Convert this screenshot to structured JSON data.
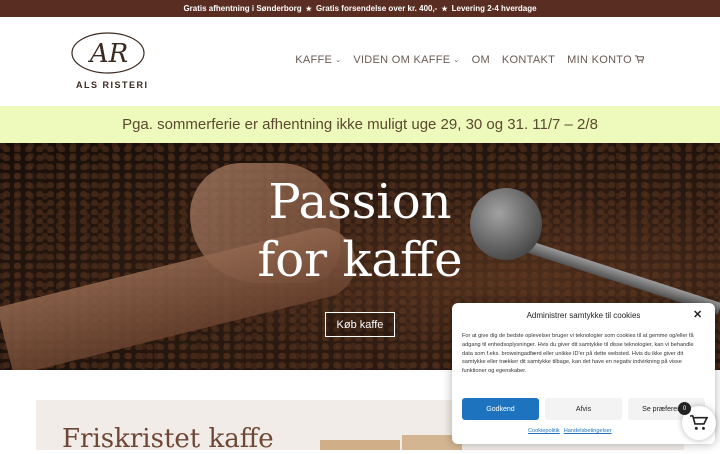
{
  "topbar": {
    "item1": "Gratis afhentning i Sønderborg",
    "item2": "Gratis forsendelse over kr. 400,-",
    "item3": "Levering 2-4 hverdage",
    "separator": "★"
  },
  "header": {
    "logo_monogram": "AR",
    "logo_text": "ALS RISTERI",
    "nav": {
      "kaffe": "KAFFE",
      "viden": "VIDEN OM KAFFE",
      "om": "OM",
      "kontakt": "KONTAKT",
      "konto": "MIN KONTO"
    },
    "chevron_icon": "chevron-down-icon",
    "cart_icon": "cart-icon"
  },
  "notice": {
    "text": "Pga. sommerferie er afhentning ikke muligt uge 29, 30 og 31. 11/7 – 2/8"
  },
  "hero": {
    "title_line1": "Passion",
    "title_line2": "for kaffe",
    "button": "Køb kaffe"
  },
  "section": {
    "title": "Friskristet kaffe"
  },
  "cookie": {
    "title": "Administrer samtykke til cookies",
    "close_icon": "close-icon",
    "body": "For at give dig de bedste oplevelser bruger vi teknologier som cookies til at gemme og/eller få adgang til enhedsoplysninger. Hvis du giver dit samtykke til disse teknologier, kan vi behandle data som f.eks. browsingadfærd eller unikke ID'er på dette websted. Hvis du ikke giver dit samtykke eller trækker dit samtykke tilbage, kan det have en negativ indvirkning på visse funktioner og egenskaber.",
    "accept": "Godkend",
    "deny": "Afvis",
    "prefs": "Se præferencer",
    "link_policy": "Cookiepolitik",
    "link_terms": "Handelsbetingelser"
  },
  "floating_cart": {
    "count": "0",
    "icon": "cart-icon"
  },
  "colors": {
    "topbar_bg": "#5a2d22",
    "notice_bg": "#eefabc",
    "accent_blue": "#1e73be",
    "heading_brown": "#6e4736"
  }
}
